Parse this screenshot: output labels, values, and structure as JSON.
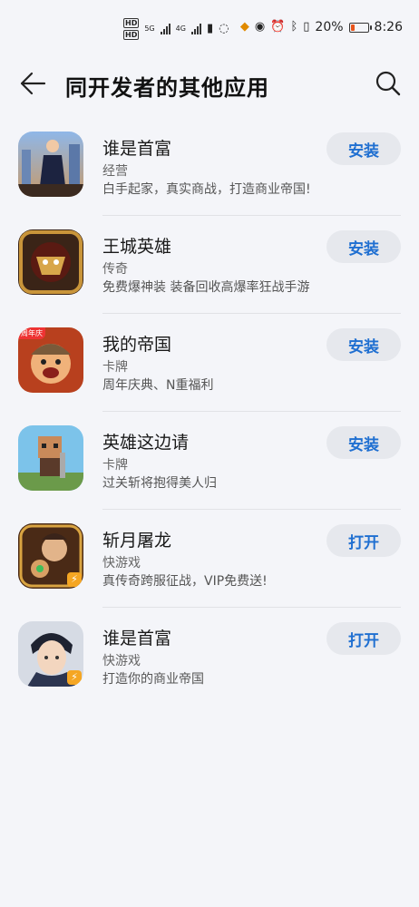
{
  "status_bar": {
    "hd1": "HD",
    "hd2": "HD",
    "net1": "5G",
    "net2": "4G",
    "battery_percent": "20%",
    "time": "8:26",
    "battery_level": 0.2,
    "battery_color": "#e8541b"
  },
  "header": {
    "title": "同开发者的其他应用",
    "back_icon": "arrow-left-icon",
    "search_icon": "search-icon"
  },
  "apps": [
    {
      "name": "谁是首富",
      "category": "经营",
      "description": "白手起家，真实商战，打造商业帝国!",
      "action": "安装"
    },
    {
      "name": "王城英雄",
      "category": "传奇",
      "description": "免费爆神装 装备回收高爆率狂战手游",
      "action": "安装"
    },
    {
      "name": "我的帝国",
      "category": "卡牌",
      "description": "周年庆典、N重福利",
      "action": "安装",
      "tag": "周年庆"
    },
    {
      "name": "英雄这边请",
      "category": "卡牌",
      "description": "过关斩将抱得美人归",
      "action": "安装"
    },
    {
      "name": "斩月屠龙",
      "category": "快游戏",
      "description": "真传奇跨服征战，VIP免费送!",
      "action": "打开",
      "badge": "⚡"
    },
    {
      "name": "谁是首富",
      "category": "快游戏",
      "description": "打造你的商业帝国",
      "action": "打开",
      "badge": "⚡"
    }
  ],
  "colors": {
    "accent": "#1f6fd1",
    "button_bg": "#e6e8ed",
    "background": "#f4f5f9"
  }
}
